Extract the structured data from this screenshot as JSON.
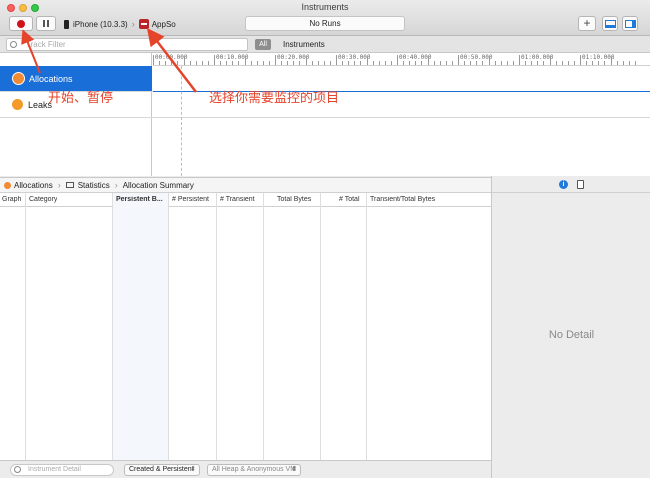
{
  "window": {
    "title": "Instruments"
  },
  "toolbar": {
    "device": "iPhone (10.3.3)",
    "app": "AppSo",
    "run_status": "No Runs"
  },
  "filter": {
    "placeholder": "Track Filter",
    "scope": "All",
    "scope_label": "Instruments"
  },
  "timeline": {
    "ticks": [
      "00:00.000",
      "00:10.000",
      "00:20.000",
      "00:30.000",
      "00:40.000",
      "00:50.000",
      "01:00.000",
      "01:10.000"
    ]
  },
  "tracks": [
    {
      "label": "Allocations",
      "icon": "allocations-icon",
      "selected": true
    },
    {
      "label": "Leaks",
      "icon": "leaks-icon",
      "selected": false
    }
  ],
  "jumpbar": {
    "instrument": "Allocations",
    "view": "Statistics",
    "detail": "Allocation Summary"
  },
  "table": {
    "columns": [
      "Graph",
      "Category",
      "Persistent B...",
      "# Persistent",
      "# Transient",
      "Total Bytes",
      "# Total",
      "Transient/Total Bytes"
    ]
  },
  "bottombar": {
    "detail_placeholder": "Instrument Detail",
    "allocation_type": "Created & Persistent",
    "heap_scope": "All Heap & Anonymous VM"
  },
  "inspector": {
    "empty_text": "No Detail"
  },
  "annotations": {
    "record_pause": "开始、暂停",
    "select_target": "选择你需要监控的项目",
    "color": "#e5432a"
  },
  "colors": {
    "accent": "#1a6ed8",
    "record": "#d1111a",
    "allocations": "#f18a33"
  }
}
